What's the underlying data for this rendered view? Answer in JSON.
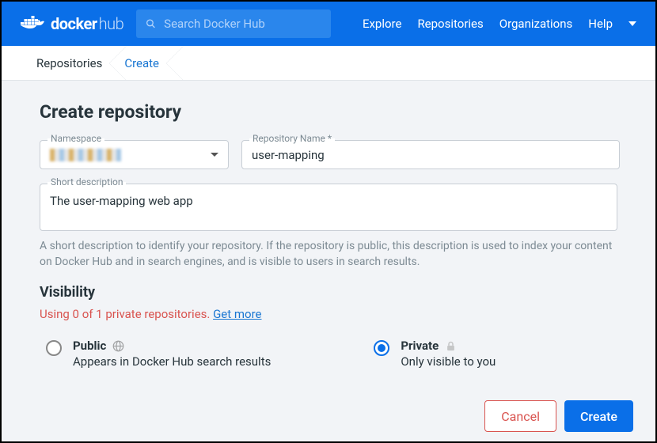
{
  "logo": {
    "bold": "docker",
    "light": "hub"
  },
  "search": {
    "placeholder": "Search Docker Hub"
  },
  "nav": {
    "explore": "Explore",
    "repositories": "Repositories",
    "organizations": "Organizations",
    "help": "Help"
  },
  "crumbs": {
    "repos": "Repositories",
    "create": "Create"
  },
  "page": {
    "title": "Create repository",
    "namespace_label": "Namespace",
    "repo_name_label": "Repository Name *",
    "repo_name_value": "user-mapping",
    "short_desc_label": "Short description",
    "short_desc_value": "The user-mapping web app",
    "helper_text": "A short description to identify your repository. If the repository is public, this description is used to index your content on Docker Hub and in search engines, and is visible to users in search results.",
    "visibility_title": "Visibility",
    "quota_text": "Using 0 of 1 private repositories. ",
    "quota_link": "Get more",
    "public": {
      "title": "Public",
      "sub": "Appears in Docker Hub search results"
    },
    "private": {
      "title": "Private",
      "sub": "Only visible to you"
    },
    "selected_visibility": "private",
    "cancel": "Cancel",
    "create": "Create"
  }
}
